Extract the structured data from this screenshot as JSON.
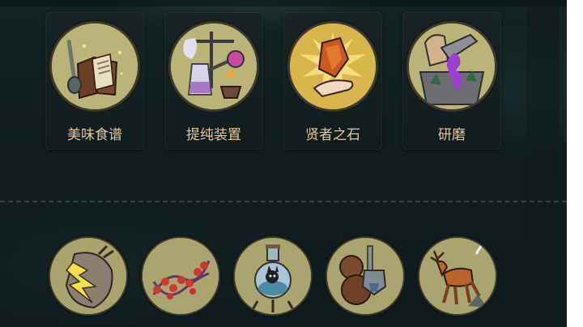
{
  "cards": [
    {
      "label": "美味食谱",
      "icon": "cookbook-icon"
    },
    {
      "label": "提纯装置",
      "icon": "distillation-apparatus-icon"
    },
    {
      "label": "贤者之石",
      "icon": "philosopher-stone-icon"
    },
    {
      "label": "研磨",
      "icon": "grinding-icon"
    }
  ],
  "bottom_items": [
    {
      "icon": "lightning-beast-icon"
    },
    {
      "icon": "red-dna-helix-icon"
    },
    {
      "icon": "creature-in-flask-icon"
    },
    {
      "icon": "mechanical-gourd-icon"
    },
    {
      "icon": "deer-icon"
    }
  ],
  "colors": {
    "background": "#111d1f",
    "card_bg": "#172325",
    "medallion": "#b9b377",
    "label": "#e6c79a"
  }
}
